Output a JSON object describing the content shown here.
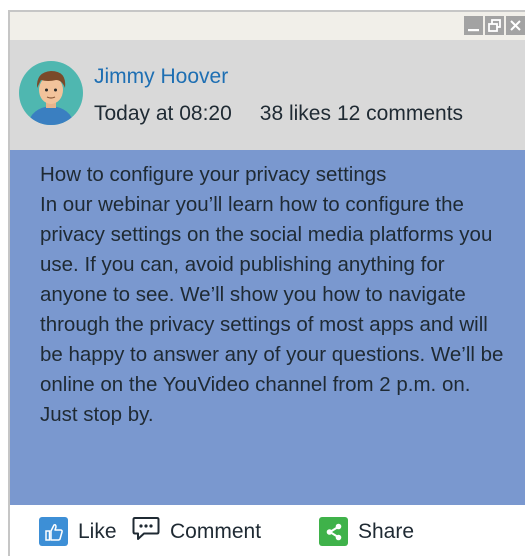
{
  "post": {
    "author": "Jimmy Hoover",
    "time": "Today at 08:20",
    "likes": "38 likes",
    "comments": "12 comments",
    "title": "How to configure your privacy settings",
    "body": "In our webinar you’ll learn how to configure the privacy settings on the social media platforms you use. If you can, avoid publishing anything for anyone to see. We’ll show you how to navigate through the privacy settings of most apps and will be happy to answer any of your questions. We’ll be online on the YouVideo channel from 2 p.m. on. Just stop by."
  },
  "actions": {
    "like": "Like",
    "comment": "Comment",
    "share": "Share"
  },
  "window_controls": [
    "minimize-icon",
    "restore-icon",
    "close-icon"
  ],
  "colors": {
    "titlebar": "#f1efe9",
    "header": "#d9d9d9",
    "body": "#7a98cf",
    "author_link": "#1e6fb3",
    "like_icon": "#3d8fd6",
    "share_icon": "#3fb24a"
  }
}
